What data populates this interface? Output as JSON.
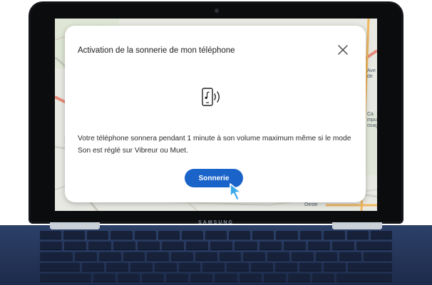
{
  "device": {
    "brand": "SAMSUNG"
  },
  "dialog": {
    "title": "Activation de la sonnerie de mon téléphone",
    "message": "Votre téléphone sonnera pendant 1 minute à son volume maximum même si le mode Son est réglé sur Vibreur ou Muet.",
    "ring_button_label": "Sonnerie",
    "icons": {
      "close": "close-icon",
      "ring": "phone-ring-icon",
      "cursor": "hand-cursor-icon"
    }
  },
  "map_labels": [
    "Ave",
    "de",
    "Ca",
    "mpus",
    "osag",
    "Oeste"
  ],
  "colors": {
    "accent": "#1a63c9",
    "laptop_body": "#1d2b4b"
  }
}
